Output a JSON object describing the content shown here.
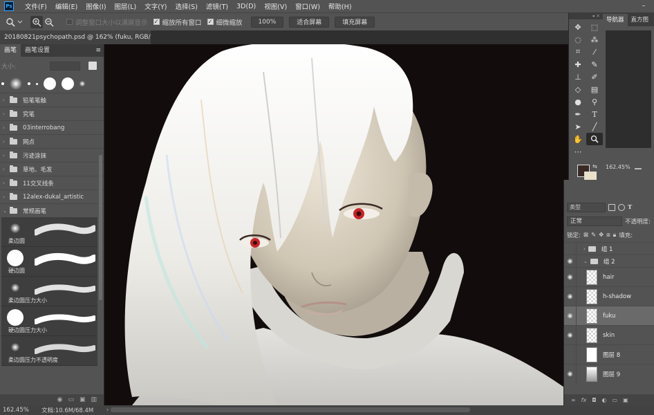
{
  "menubar": {
    "logo": "Ps",
    "items": [
      "文件(F)",
      "编辑(E)",
      "图像(I)",
      "图层(L)",
      "文字(Y)",
      "选择(S)",
      "滤镜(T)",
      "3D(D)",
      "视图(V)",
      "窗口(W)",
      "帮助(H)"
    ]
  },
  "options": {
    "resize_windows": "调整窗口大小以满屏显示",
    "zoom_all": "缩放所有窗口",
    "scrubby_zoom": "细微缩放",
    "zoom_value": "100%",
    "fit_screen": "适合屏幕",
    "fill_screen": "填充屏幕"
  },
  "document": {
    "tab_title": "20180821psychopath.psd @ 162% (fuku, RGB/8) *",
    "close": "×"
  },
  "brushes": {
    "tabs": [
      "画笔",
      "画笔设置"
    ],
    "size_label": "大小:",
    "folders": [
      "铅笔笔触",
      "究笔",
      "03interrobang",
      "网点",
      "污迹涂抹",
      "草地、毛发",
      "11交叉线条",
      "12alex-dukal_artistic",
      "常规画笔"
    ],
    "presets": [
      "柔边圆",
      "硬边圆",
      "柔边圆压力大小",
      "硬边圆压力大小",
      "柔边圆压力不透明度"
    ]
  },
  "navigator": {
    "tabs": [
      "导航器",
      "直方图"
    ],
    "zoom": "162.45%"
  },
  "layers": {
    "filter": "类型",
    "blend_mode": "正常",
    "opacity_label": "不透明度:",
    "lock_label": "锁定:",
    "fill_label": "填充:",
    "items": [
      "组 1",
      "组 2",
      "hair",
      "h-shadow",
      "fuku",
      "skin",
      "图层 8",
      "图层 9"
    ]
  },
  "status": {
    "zoom": "162.45%",
    "doc": "文档:10.6M/68.4M",
    "arrow": "›"
  },
  "colors": {
    "foreground": "#3a2a26",
    "background": "#e9e2c8",
    "eye_red": "#c8242a"
  }
}
